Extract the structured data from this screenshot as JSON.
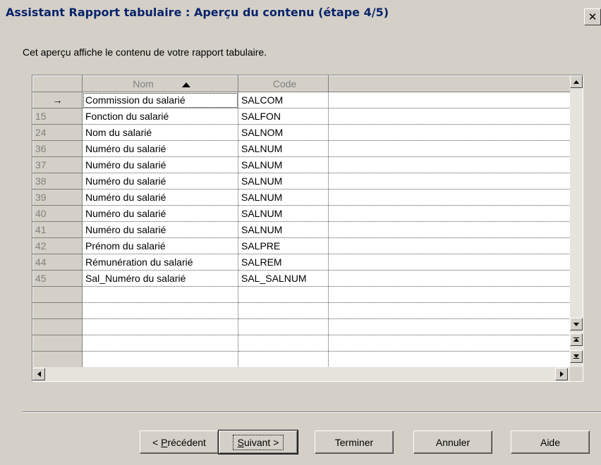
{
  "window": {
    "title": "Assistant Rapport tabulaire : Aperçu du contenu (étape 4/5)",
    "close_glyph": "✕"
  },
  "intro_text": "Cet aperçu affiche le contenu de votre rapport tabulaire.",
  "grid": {
    "columns": [
      "Nom",
      "Code",
      ""
    ],
    "sorted_column": "Nom",
    "current_row_marker": "→",
    "rows": [
      {
        "rowhdr": "→",
        "nom": "Commission du salarié",
        "code": "SALCOM"
      },
      {
        "rowhdr": "15",
        "nom": "Fonction du salarié",
        "code": "SALFON"
      },
      {
        "rowhdr": "24",
        "nom": "Nom du salarié",
        "code": "SALNOM"
      },
      {
        "rowhdr": "36",
        "nom": "Numéro du salarié",
        "code": "SALNUM"
      },
      {
        "rowhdr": "37",
        "nom": "Numéro du salarié",
        "code": "SALNUM"
      },
      {
        "rowhdr": "38",
        "nom": "Numéro du salarié",
        "code": "SALNUM"
      },
      {
        "rowhdr": "39",
        "nom": "Numéro du salarié",
        "code": "SALNUM"
      },
      {
        "rowhdr": "40",
        "nom": "Numéro du salarié",
        "code": "SALNUM"
      },
      {
        "rowhdr": "41",
        "nom": "Numéro du salarié",
        "code": "SALNUM"
      },
      {
        "rowhdr": "42",
        "nom": "Prénom du salarié",
        "code": "SALPRE"
      },
      {
        "rowhdr": "44",
        "nom": "Rémunération du salarié",
        "code": "SALREM"
      },
      {
        "rowhdr": "45",
        "nom": "Sal_Numéro du salarié",
        "code": "SAL_SALNUM"
      },
      {
        "rowhdr": "",
        "nom": "",
        "code": ""
      },
      {
        "rowhdr": "",
        "nom": "",
        "code": ""
      },
      {
        "rowhdr": "",
        "nom": "",
        "code": ""
      },
      {
        "rowhdr": "",
        "nom": "",
        "code": ""
      },
      {
        "rowhdr": "",
        "nom": "",
        "code": ""
      }
    ]
  },
  "buttons": {
    "previous": {
      "prefix": "< ",
      "mnemonic": "P",
      "rest": "récédent"
    },
    "next": {
      "mnemonic": "S",
      "rest": "uivant >"
    },
    "finish": "Terminer",
    "cancel": "Annuler",
    "help": "Aide"
  }
}
